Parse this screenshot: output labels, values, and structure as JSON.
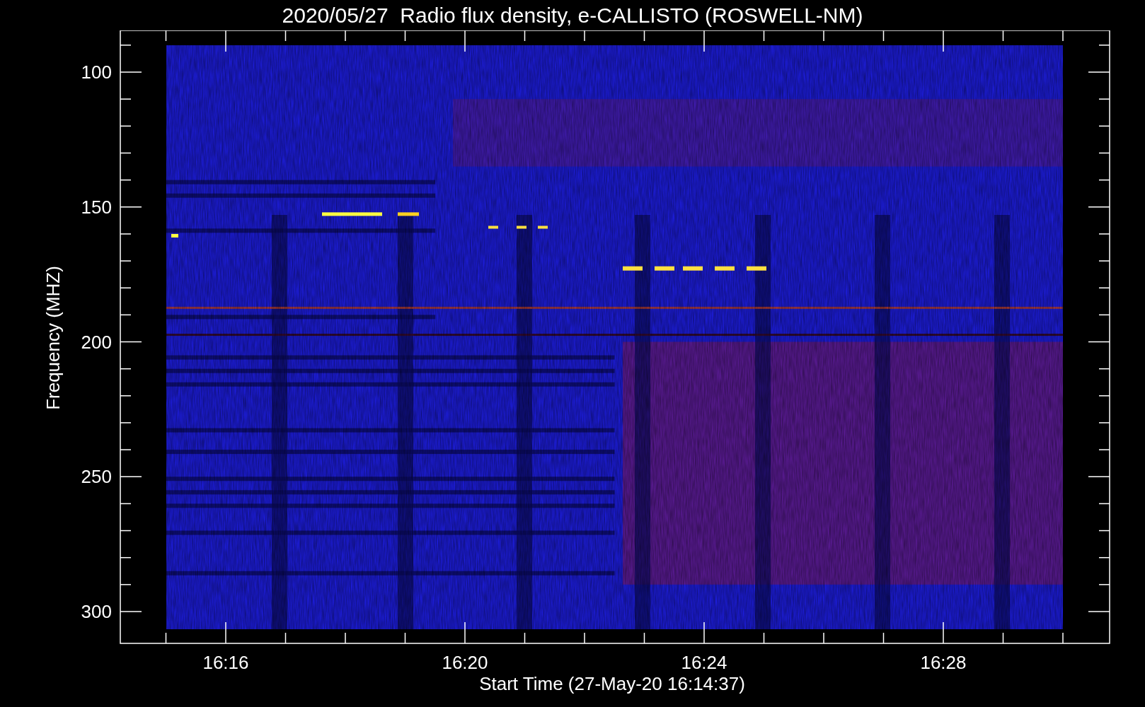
{
  "title": "2020/05/27  Radio flux density, e-CALLISTO (ROSWELL-NM)",
  "y_axis": {
    "label": "Frequency (MHZ)",
    "ticks": [
      "100",
      "150",
      "200",
      "250",
      "300"
    ]
  },
  "x_axis": {
    "label": "Start Time (27-May-20 16:14:37)",
    "ticks": [
      "16:16",
      "16:20",
      "16:24",
      "16:28"
    ]
  }
}
